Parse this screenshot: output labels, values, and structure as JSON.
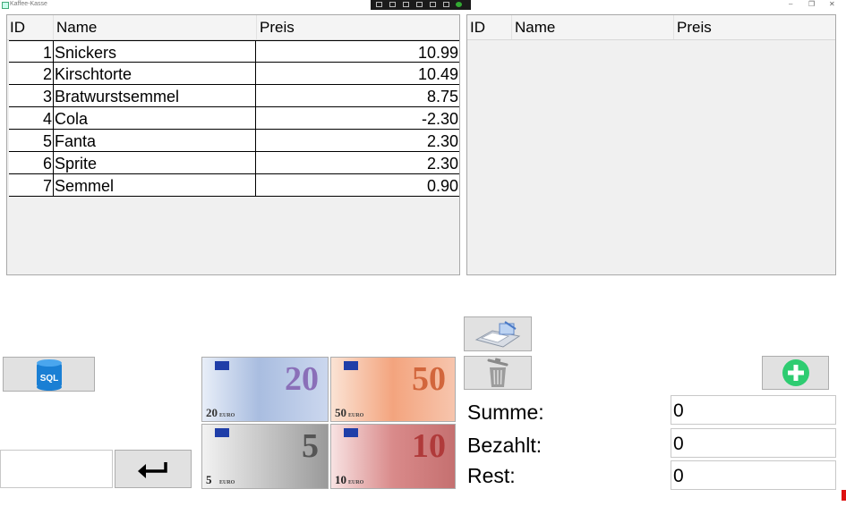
{
  "window": {
    "title": "Kaffee-Kasse",
    "controls": [
      "–",
      "❐",
      "✕"
    ]
  },
  "left_grid": {
    "columns": [
      "ID",
      "Name",
      "Preis"
    ],
    "rows": [
      {
        "id": "1",
        "name": "Snickers",
        "price": "10.99"
      },
      {
        "id": "2",
        "name": "Kirschtorte",
        "price": "10.49"
      },
      {
        "id": "3",
        "name": "Bratwurstsemmel",
        "price": "8.75"
      },
      {
        "id": "4",
        "name": "Cola",
        "price": "-2.30"
      },
      {
        "id": "5",
        "name": "Fanta",
        "price": "2.30"
      },
      {
        "id": "6",
        "name": "Sprite",
        "price": "2.30"
      },
      {
        "id": "7",
        "name": "Semmel",
        "price": "0.90"
      }
    ]
  },
  "right_grid": {
    "columns": [
      "ID",
      "Name",
      "Preis"
    ]
  },
  "sql_button": {
    "label": "SQL",
    "icon": "database-icon"
  },
  "banknotes": [
    {
      "value": "20",
      "currency": "EURO",
      "color": "#9fb4d8"
    },
    {
      "value": "50",
      "currency": "EURO",
      "color": "#f2a882"
    },
    {
      "value": "5",
      "currency": "EURO",
      "color": "#c9c9c9"
    },
    {
      "value": "10",
      "currency": "EURO",
      "color": "#dc8c8c"
    }
  ],
  "enter_button": {
    "icon": "enter-arrow-icon"
  },
  "register_button": {
    "icon": "cash-register-icon"
  },
  "delete_button": {
    "icon": "trash-icon"
  },
  "add_button": {
    "icon": "add-icon"
  },
  "summary": {
    "summe_label": "Summe:",
    "summe_value": "0",
    "bezahlt_label": "Bezahlt:",
    "bezahlt_value": "0",
    "rest_label": "Rest:",
    "rest_value": "0"
  },
  "colors": {
    "accent_green": "#2ecc71",
    "sql_blue": "#1a7fd4",
    "row_border": "#000000"
  }
}
